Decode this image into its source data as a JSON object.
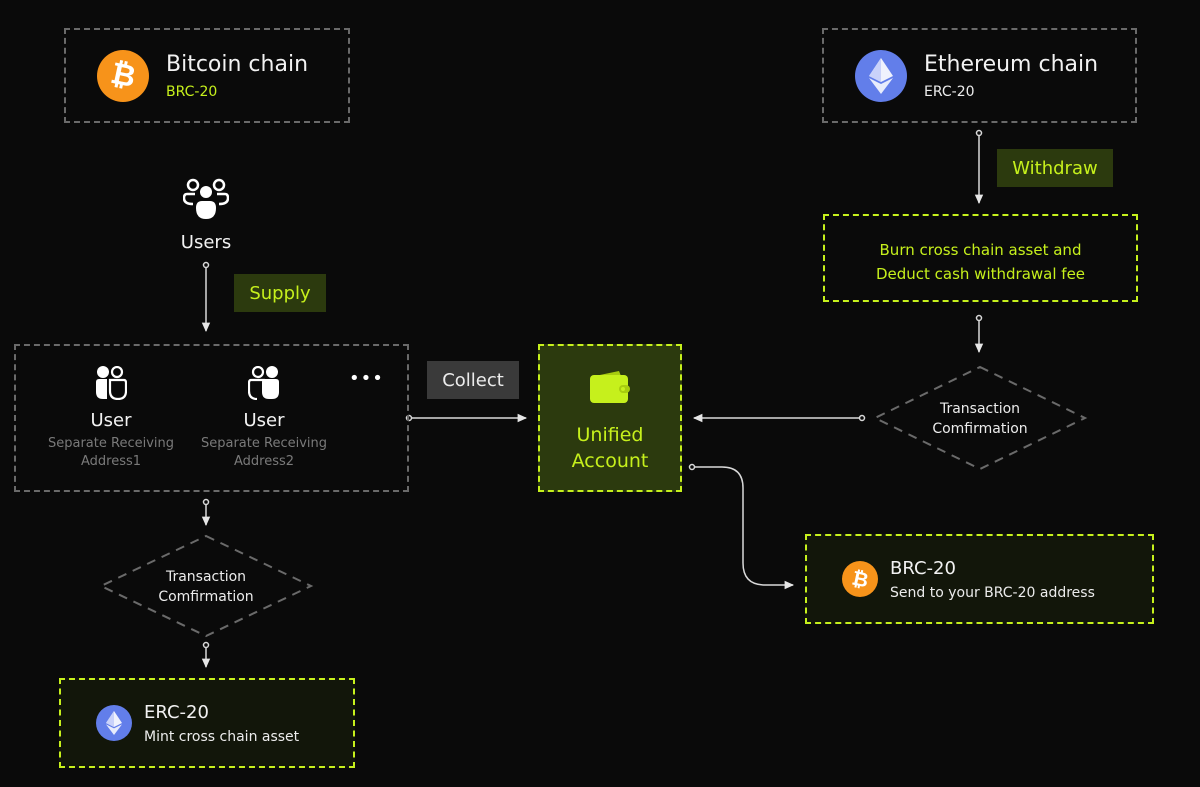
{
  "colors": {
    "accent": "#c6f01c",
    "background": "#0a0a0a",
    "bitcoin": "#f7931a",
    "ethereum": "#627eea",
    "tag_bg": "#2c3a0e"
  },
  "bitcoin_chain": {
    "title": "Bitcoin chain",
    "subtitle": "BRC-20",
    "icon": "bitcoin-icon"
  },
  "ethereum_chain": {
    "title": "Ethereum chain",
    "subtitle": "ERC-20",
    "icon": "ethereum-icon"
  },
  "users": {
    "label": "Users",
    "icon": "users-group-icon"
  },
  "supply_tag": "Supply",
  "collect_tag": "Collect",
  "withdraw_tag": "Withdraw",
  "receiving_group": {
    "users": [
      {
        "name": "User",
        "sub_line1": "Separate Receiving",
        "sub_line2": "Address1",
        "icon": "user-pair-icon"
      },
      {
        "name": "User",
        "sub_line1": "Separate Receiving",
        "sub_line2": "Address2",
        "icon": "user-pair-icon"
      }
    ],
    "more": "•••"
  },
  "unified_account": {
    "line1": "Unified",
    "line2": "Account",
    "icon": "wallet-icon"
  },
  "burn_box": {
    "line1": "Burn cross chain asset and",
    "line2": "Deduct cash withdrawal fee"
  },
  "confirm_left": {
    "line1": "Transaction",
    "line2": "Comfirmation"
  },
  "confirm_right": {
    "line1": "Transaction",
    "line2": "Comfirmation"
  },
  "mint_result": {
    "title": "ERC-20",
    "subtitle": "Mint cross chain asset",
    "icon": "ethereum-icon"
  },
  "send_result": {
    "title": "BRC-20",
    "subtitle": "Send to your BRC-20 address",
    "icon": "bitcoin-icon"
  }
}
